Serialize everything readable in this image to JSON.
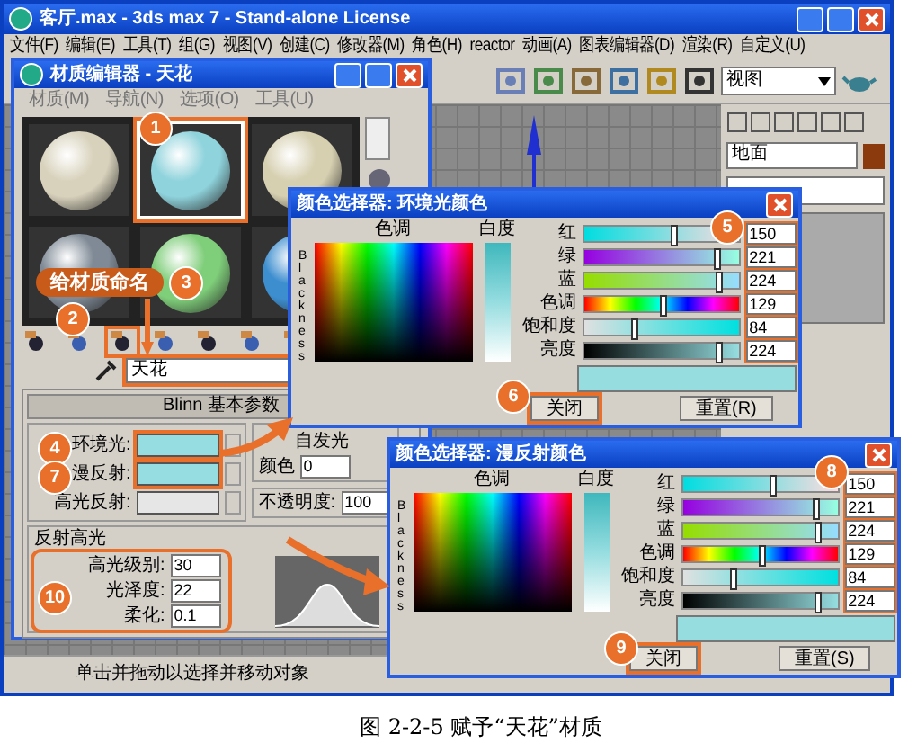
{
  "main_window": {
    "title": "客厅.max - 3ds max 7 - Stand-alone License",
    "menu": [
      "文件(F)",
      "编辑(E)",
      "工具(T)",
      "组(G)",
      "视图(V)",
      "创建(C)",
      "修改器(M)",
      "角色(H)",
      "reactor",
      "动画(A)",
      "图表编辑器(D)",
      "渲染(R)",
      "自定义(U)"
    ],
    "view_dropdown": "视图",
    "object_name": "地面",
    "status": "单击并拖动以选择并移动对象"
  },
  "material_editor": {
    "title": "材质编辑器 - 天花",
    "menu": [
      "材质(M)",
      "导航(N)",
      "选项(O)",
      "工具(U)"
    ],
    "slots": [
      {
        "color": "#d8d2bc",
        "selected": false
      },
      {
        "color": "#8fd3dc",
        "selected": true
      },
      {
        "color": "#d6cfb0",
        "selected": false
      },
      {
        "color": "#7f8a96",
        "selected": false
      },
      {
        "color": "#7fce7a",
        "selected": false
      },
      {
        "color": "#3d8ecf",
        "selected": false
      }
    ],
    "material_name": "天花",
    "rollout_title": "Blinn 基本参数",
    "self_illum_title": "自发光",
    "self_illum_label": "颜色",
    "self_illum_value": "0",
    "colors": [
      {
        "label": "环境光:",
        "color": "#96dde2"
      },
      {
        "label": "漫反射:",
        "color": "#96dde2"
      },
      {
        "label": "高光反射:",
        "color": "#e6e6e6"
      }
    ],
    "opacity_label": "不透明度:",
    "opacity_value": "100",
    "highlight_title": "反射高光",
    "highlight_params": [
      {
        "label": "高光级别:",
        "value": "30"
      },
      {
        "label": "光泽度:",
        "value": "22"
      },
      {
        "label": "柔化:",
        "value": "0.1"
      }
    ]
  },
  "color_pickers": [
    {
      "title": "颜色选择器: 环境光颜色",
      "hue_label": "色调",
      "whiteness_label": "白度",
      "blackness_label": "Blackness",
      "close": "关闭",
      "reset": "重置(R)",
      "channels": [
        {
          "kind": "red",
          "label": "红",
          "value": "150",
          "level": 0.59
        },
        {
          "kind": "green",
          "label": "绿",
          "value": "221",
          "level": 0.87
        },
        {
          "kind": "blue",
          "label": "蓝",
          "value": "224",
          "level": 0.88
        },
        {
          "kind": "hue",
          "label": "色调",
          "value": "129",
          "level": 0.51
        },
        {
          "kind": "sat",
          "label": "饱和度",
          "value": "84",
          "level": 0.33
        },
        {
          "kind": "val",
          "label": "亮度",
          "value": "224",
          "level": 0.88
        }
      ]
    },
    {
      "title": "颜色选择器: 漫反射颜色",
      "hue_label": "色调",
      "whiteness_label": "白度",
      "blackness_label": "Blackness",
      "close": "关闭",
      "reset": "重置(S)",
      "channels": [
        {
          "kind": "red",
          "label": "红",
          "value": "150",
          "level": 0.59
        },
        {
          "kind": "green",
          "label": "绿",
          "value": "221",
          "level": 0.87
        },
        {
          "kind": "blue",
          "label": "蓝",
          "value": "224",
          "level": 0.88
        },
        {
          "kind": "hue",
          "label": "色调",
          "value": "129",
          "level": 0.51
        },
        {
          "kind": "sat",
          "label": "饱和度",
          "value": "84",
          "level": 0.33
        },
        {
          "kind": "val",
          "label": "亮度",
          "value": "224",
          "level": 0.88
        }
      ]
    }
  ],
  "annotations": {
    "badges": [
      "1",
      "2",
      "3",
      "4",
      "5",
      "6",
      "7",
      "8",
      "9",
      "10"
    ],
    "callout": "给材质命名"
  },
  "caption": "图 2-2-5  赋予“天花”材质"
}
